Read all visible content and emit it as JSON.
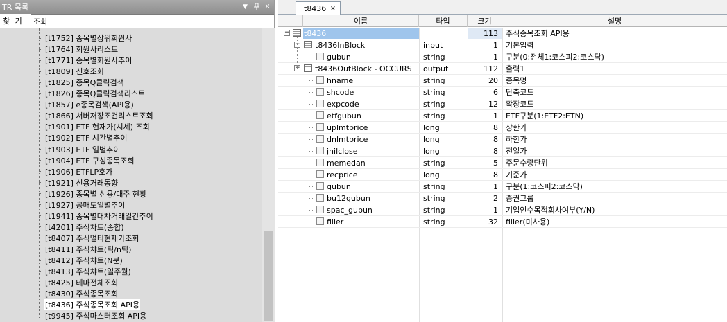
{
  "left_panel": {
    "title": "TR 목록",
    "search_label": "찾 기",
    "search_value": "조회",
    "items": [
      "[t1752] 종목별상위회원사",
      "[t1764] 회원사리스트",
      "[t1771] 종목별회원사추이",
      "[t1809] 신호조회",
      "[t1825] 종목Q클릭검색",
      "[t1826] 종목Q클릭검색리스트",
      "[t1857] e종목검색(API용)",
      "[t1866] 서버저장조건리스트조회",
      "[t1901] ETF 현재가(시세) 조회",
      "[t1902] ETF 시간별추이",
      "[t1903] ETF 일별추이",
      "[t1904] ETF 구성종목조회",
      "[t1906] ETFLP호가",
      "[t1921] 신용거래동향",
      "[t1926] 종목별 신용/대주 현황",
      "[t1927] 공매도일별추이",
      "[t1941] 종목별대차거래일간추이",
      "[t4201] 주식차트(종합)",
      "[t8407] 주식멀티현재가조회",
      "[t8411] 주식챠트(틱/n틱)",
      "[t8412] 주식챠트(N분)",
      "[t8413] 주식챠트(일주월)",
      "[t8425] 테마전체조회",
      "[t8430] 주식종목조회",
      "[t8436] 주식종목조회 API용",
      "[t9945] 주식마스터조회 API용"
    ],
    "selected_index": 24
  },
  "right_panel": {
    "tab": {
      "label": "t8436",
      "close": "×"
    },
    "columns": [
      "이름",
      "타입",
      "크기",
      "설명"
    ],
    "rows": [
      {
        "name": "t8436",
        "type": "",
        "size": "113",
        "desc": "주식종목조회 API용",
        "level": 0,
        "kind": "root"
      },
      {
        "name": "t8436InBlock",
        "type": "input",
        "size": "1",
        "desc": "기본입력",
        "level": 1,
        "kind": "block"
      },
      {
        "name": "gubun",
        "type": "string",
        "size": "1",
        "desc": "구분(0:전체1:코스피2:코스닥)",
        "level": 2,
        "kind": "field"
      },
      {
        "name": "t8436OutBlock - OCCURS",
        "type": "output",
        "size": "112",
        "desc": "출력1",
        "level": 1,
        "kind": "block"
      },
      {
        "name": "hname",
        "type": "string",
        "size": "20",
        "desc": "종목명",
        "level": 2,
        "kind": "field"
      },
      {
        "name": "shcode",
        "type": "string",
        "size": "6",
        "desc": "단축코드",
        "level": 2,
        "kind": "field"
      },
      {
        "name": "expcode",
        "type": "string",
        "size": "12",
        "desc": "확장코드",
        "level": 2,
        "kind": "field"
      },
      {
        "name": "etfgubun",
        "type": "string",
        "size": "1",
        "desc": "ETF구분(1:ETF2:ETN)",
        "level": 2,
        "kind": "field"
      },
      {
        "name": "uplmtprice",
        "type": "long",
        "size": "8",
        "desc": "상한가",
        "level": 2,
        "kind": "field"
      },
      {
        "name": "dnlmtprice",
        "type": "long",
        "size": "8",
        "desc": "하한가",
        "level": 2,
        "kind": "field"
      },
      {
        "name": "jnilclose",
        "type": "long",
        "size": "8",
        "desc": "전일가",
        "level": 2,
        "kind": "field"
      },
      {
        "name": "memedan",
        "type": "string",
        "size": "5",
        "desc": "주문수량단위",
        "level": 2,
        "kind": "field"
      },
      {
        "name": "recprice",
        "type": "long",
        "size": "8",
        "desc": "기준가",
        "level": 2,
        "kind": "field"
      },
      {
        "name": "gubun",
        "type": "string",
        "size": "1",
        "desc": "구분(1:코스피2:코스닥)",
        "level": 2,
        "kind": "field"
      },
      {
        "name": "bu12gubun",
        "type": "string",
        "size": "2",
        "desc": "증권그룹",
        "level": 2,
        "kind": "field"
      },
      {
        "name": "spac_gubun",
        "type": "string",
        "size": "1",
        "desc": "기업인수목적회사여부(Y/N)",
        "level": 2,
        "kind": "field"
      },
      {
        "name": "filler",
        "type": "string",
        "size": "32",
        "desc": "filler(미사용)",
        "level": 2,
        "kind": "field"
      }
    ],
    "selected_row": 0
  },
  "icons": {
    "collapse": "⊟",
    "dropdown": "▼",
    "pin": "pin-icon",
    "close": "close-icon"
  },
  "colors": {
    "left_title_bar": "#9a9a9a",
    "tree_background": "#dcdcdc",
    "grid_selection": "#9fc5ec"
  }
}
